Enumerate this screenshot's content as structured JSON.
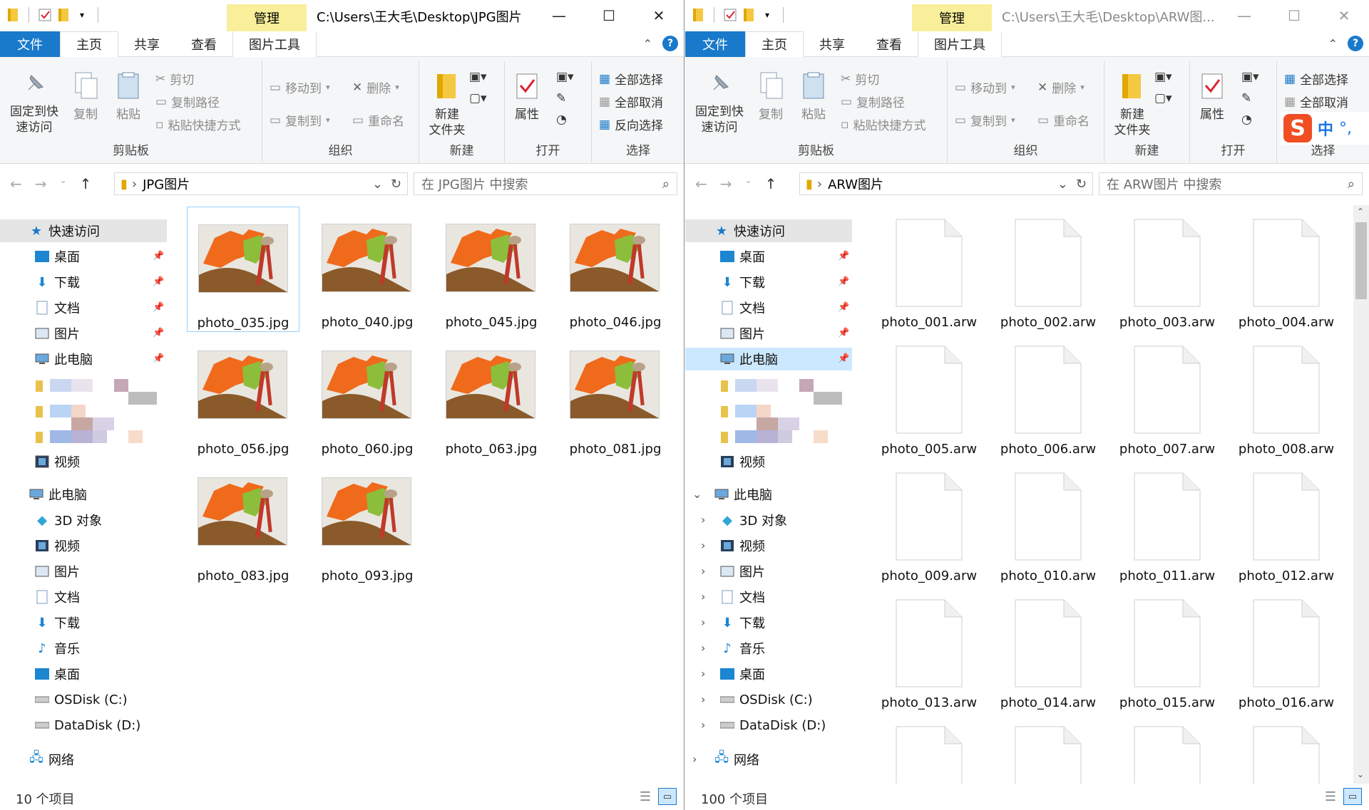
{
  "left": {
    "title": "C:\\Users\\王大毛\\Desktop\\JPG图片",
    "context_tab": "管理",
    "tabs": [
      "文件",
      "主页",
      "共享",
      "查看",
      "图片工具"
    ],
    "ribbon": {
      "pin": "固定到快\n速访问",
      "copy": "复制",
      "paste": "粘贴",
      "cut": "剪切",
      "copy_path": "复制路径",
      "paste_shortcut": "粘贴快捷方式",
      "clipboard": "剪贴板",
      "move_to": "移动到",
      "copy_to": "复制到",
      "delete": "删除",
      "rename": "重命名",
      "organize": "组织",
      "new_folder": "新建\n文件夹",
      "new": "新建",
      "properties": "属性",
      "open": "打开",
      "select_all": "全部选择",
      "select_none": "全部取消",
      "invert": "反向选择",
      "select": "选择"
    },
    "path": "JPG图片",
    "search_placeholder": "在 JPG图片 中搜索",
    "nav": {
      "quick_access": "快速访问",
      "qa_items": [
        "桌面",
        "下载",
        "文档",
        "图片",
        "此电脑"
      ],
      "videos": "视频",
      "this_pc": "此电脑",
      "pc_items": [
        "3D 对象",
        "视频",
        "图片",
        "文档",
        "下载",
        "音乐",
        "桌面",
        "OSDisk (C:)",
        "DataDisk (D:)"
      ],
      "network": "网络"
    },
    "files": [
      "photo_035.jpg",
      "photo_040.jpg",
      "photo_045.jpg",
      "photo_046.jpg",
      "photo_056.jpg",
      "photo_060.jpg",
      "photo_063.jpg",
      "photo_081.jpg",
      "photo_083.jpg",
      "photo_093.jpg"
    ],
    "status": "10 个项目"
  },
  "right": {
    "title": "C:\\Users\\王大毛\\Desktop\\ARW图...",
    "context_tab": "管理",
    "tabs": [
      "文件",
      "主页",
      "共享",
      "查看",
      "图片工具"
    ],
    "ribbon": {
      "pin": "固定到快\n速访问",
      "copy": "复制",
      "paste": "粘贴",
      "cut": "剪切",
      "copy_path": "复制路径",
      "paste_shortcut": "粘贴快捷方式",
      "clipboard": "剪贴板",
      "move_to": "移动到",
      "copy_to": "复制到",
      "delete": "删除",
      "rename": "重命名",
      "organize": "组织",
      "new_folder": "新建\n文件夹",
      "new": "新建",
      "properties": "属性",
      "open": "打开",
      "select_all": "全部选择",
      "select_none": "全部取消",
      "select": "选择"
    },
    "path": "ARW图片",
    "search_placeholder": "在 ARW图片 中搜索",
    "nav": {
      "quick_access": "快速访问",
      "qa_items": [
        "桌面",
        "下载",
        "文档",
        "图片",
        "此电脑"
      ],
      "videos": "视频",
      "this_pc": "此电脑",
      "pc_items": [
        "3D 对象",
        "视频",
        "图片",
        "文档",
        "下载",
        "音乐",
        "桌面",
        "OSDisk (C:)",
        "DataDisk (D:)"
      ],
      "network": "网络"
    },
    "files": [
      "photo_001.arw",
      "photo_002.arw",
      "photo_003.arw",
      "photo_004.arw",
      "photo_005.arw",
      "photo_006.arw",
      "photo_007.arw",
      "photo_008.arw",
      "photo_009.arw",
      "photo_010.arw",
      "photo_011.arw",
      "photo_012.arw",
      "photo_013.arw",
      "photo_014.arw",
      "photo_015.arw",
      "photo_016.arw"
    ],
    "status": "100 个项目",
    "ime": "中"
  },
  "colors": {
    "accent": "#1979ca",
    "context_tab": "#f9ef9a",
    "selection": "#cce8ff"
  }
}
